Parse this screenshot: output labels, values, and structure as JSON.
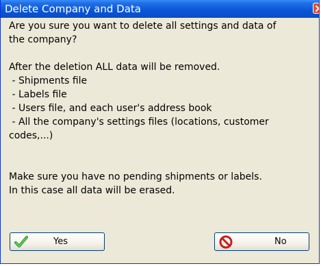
{
  "dialog": {
    "title": "Delete Company and Data",
    "lines": [
      "Are you sure you want to delete all settings and data of",
      "the company?",
      "After the deletion ALL data will be removed.",
      " - Shipments file",
      " - Labels file",
      " - Users file, and each user's address book",
      " - All the company's settings files (locations, customer",
      "codes,...)",
      "Make sure you have no pending shipments or labels.",
      "In this case all data will be erased."
    ],
    "yes_label": "Yes",
    "no_label": "No"
  },
  "icons": {
    "close": "close-icon",
    "yes": "checkmark-icon",
    "no": "no-entry-icon"
  },
  "colors": {
    "title_bar": "#0A55D6",
    "dialog_background": "#ECE9D8",
    "close_button": "#E24E2B",
    "checkmark": "#3CB043",
    "no_icon": "#D9261C"
  }
}
